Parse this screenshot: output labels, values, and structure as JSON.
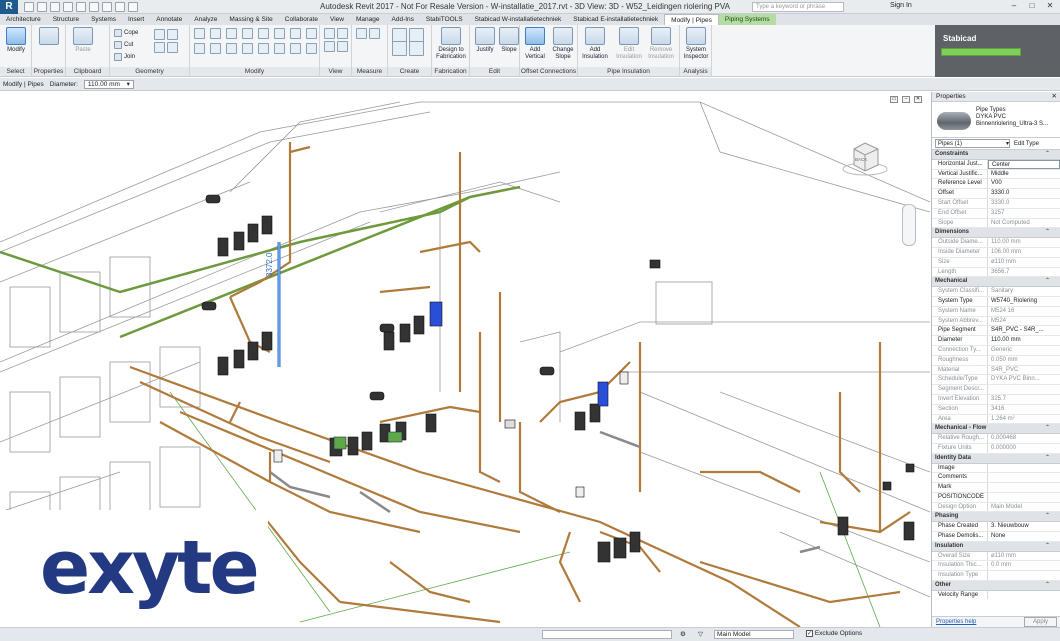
{
  "app": {
    "logo_letter": "R",
    "window_title": "Autodesk Revit 2017 -  Not For Resale Version -      W-installatie_2017.rvt - 3D View: 3D - W52_Leidingen riolering PVA",
    "search_placeholder": "Type a keyword or phrase",
    "sign_in": "Sign In"
  },
  "ribbon_tabs": [
    "Architecture",
    "Structure",
    "Systems",
    "Insert",
    "Annotate",
    "Analyze",
    "Massing & Site",
    "Collaborate",
    "View",
    "Manage",
    "Add-Ins",
    "StabiTOOLS",
    "Stabicad W-installatietechniek",
    "Stabicad E-installatietechniek",
    "Modify | Pipes",
    "Piping Systems"
  ],
  "ribbon": {
    "select": {
      "button": "Modify",
      "label": "Select"
    },
    "properties": {
      "label": "Properties"
    },
    "clipboard": {
      "paste": "Paste",
      "label": "Clipboard"
    },
    "geometry": {
      "cope": "Cope",
      "cut": "Cut",
      "join": "Join",
      "label": "Geometry"
    },
    "modify": {
      "label": "Modify"
    },
    "view": {
      "label": "View"
    },
    "measure": {
      "label": "Measure"
    },
    "create": {
      "label": "Create"
    },
    "fabrication": {
      "button": "Design to Fabrication",
      "label": "Fabrication"
    },
    "edit": {
      "justify": "Justify",
      "slope": "Slope",
      "label": "Edit"
    },
    "offset": {
      "add_vertical": "Add Vertical",
      "change_slope": "Change Slope",
      "label": "Offset Connections"
    },
    "insulation": {
      "add": "Add Insulation",
      "edit": "Edit Insulation",
      "remove": "Remove Insulation",
      "label": "Pipe Insulation"
    },
    "analysis": {
      "button": "System Inspector",
      "label": "Analysis"
    }
  },
  "stabicad": {
    "title": "Stabicad"
  },
  "options_bar": {
    "context": "Modify | Pipes",
    "diameter_label": "Diameter:",
    "diameter_value": "110.00 mm"
  },
  "viewport": {
    "dimension_label": "3372.0",
    "viewcube_face": "BACK"
  },
  "logo": {
    "text": "exyte",
    "color": "#233a83"
  },
  "properties": {
    "title": "Properties",
    "family": "Pipe Types",
    "type_name": "DYKA PVC",
    "type_sub": "Binnenriolering_Ultra-3 S...",
    "filter": "Pipes (1)",
    "edit_type": "Edit Type",
    "sections": [
      {
        "name": "Constraints",
        "rows": [
          {
            "k": "Horizontal Just...",
            "v": "Center",
            "edit": true
          },
          {
            "k": "Vertical Justific...",
            "v": "Middle"
          },
          {
            "k": "Reference Level",
            "v": "V00"
          },
          {
            "k": "Offset",
            "v": "3330.0"
          },
          {
            "k": "Start Offset",
            "v": "3330.0",
            "dim": true
          },
          {
            "k": "End Offset",
            "v": "3257",
            "dim": true
          },
          {
            "k": "Slope",
            "v": "Not Computed",
            "dim": true
          }
        ]
      },
      {
        "name": "Dimensions",
        "rows": [
          {
            "k": "Outside Diame...",
            "v": "110.00 mm",
            "dim": true
          },
          {
            "k": "Inside Diameter",
            "v": "106.00 mm",
            "dim": true
          },
          {
            "k": "Size",
            "v": "ø110 mm",
            "dim": true
          },
          {
            "k": "Length",
            "v": "3656.7",
            "dim": true
          }
        ]
      },
      {
        "name": "Mechanical",
        "rows": [
          {
            "k": "System Classifi...",
            "v": "Sanitary",
            "dim": true
          },
          {
            "k": "System Type",
            "v": "W5740_Riolering"
          },
          {
            "k": "System Name",
            "v": "M524 16",
            "dim": true
          },
          {
            "k": "System Abbrev...",
            "v": "M524",
            "dim": true
          },
          {
            "k": "Pipe Segment",
            "v": "S4R_PVC - S4R_..."
          },
          {
            "k": "Diameter",
            "v": "110.00 mm"
          },
          {
            "k": "Connection Ty...",
            "v": "Generic",
            "dim": true
          },
          {
            "k": "Roughness",
            "v": "0.050 mm",
            "dim": true
          },
          {
            "k": "Material",
            "v": "S4R_PVC",
            "dim": true
          },
          {
            "k": "Schedule/Type",
            "v": "DYKA PVC Binn...",
            "dim": true
          },
          {
            "k": "Segment Descr...",
            "v": "",
            "dim": true
          },
          {
            "k": "Invert Elevation",
            "v": "325.7",
            "dim": true
          },
          {
            "k": "Section",
            "v": "3416",
            "dim": true
          },
          {
            "k": "Area",
            "v": "1.264 m²",
            "dim": true
          }
        ]
      },
      {
        "name": "Mechanical - Flow",
        "rows": [
          {
            "k": "Relative Rough...",
            "v": "0.000468",
            "dim": true
          },
          {
            "k": "Fixture Units",
            "v": "0.000000",
            "dim": true
          }
        ]
      },
      {
        "name": "Identity Data",
        "rows": [
          {
            "k": "Image",
            "v": ""
          },
          {
            "k": "Comments",
            "v": ""
          },
          {
            "k": "Mark",
            "v": ""
          },
          {
            "k": "POSITIONCODE",
            "v": ""
          },
          {
            "k": "Design Option",
            "v": "Main Model",
            "dim": true
          }
        ]
      },
      {
        "name": "Phasing",
        "rows": [
          {
            "k": "Phase Created",
            "v": "3. Nieuwbouw"
          },
          {
            "k": "Phase Demolis...",
            "v": "None"
          }
        ]
      },
      {
        "name": "Insulation",
        "rows": [
          {
            "k": "Overall Size",
            "v": "ø110 mm",
            "dim": true
          },
          {
            "k": "Insulation Thic...",
            "v": "0.0 mm",
            "dim": true
          },
          {
            "k": "Insulation Type",
            "v": "",
            "dim": true
          }
        ]
      },
      {
        "name": "Other",
        "rows": [
          {
            "k": "Velocity Range",
            "v": ""
          }
        ]
      }
    ],
    "help": "Properties help",
    "apply": "Apply"
  },
  "status": {
    "model": "Main Model",
    "exclude": "Exclude Options"
  },
  "colors": {
    "pipe": "#b07a3a",
    "green_pipe": "#6d9a3d",
    "selected": "#2a6fd6",
    "ribbon_accent": "#b6dca5"
  }
}
